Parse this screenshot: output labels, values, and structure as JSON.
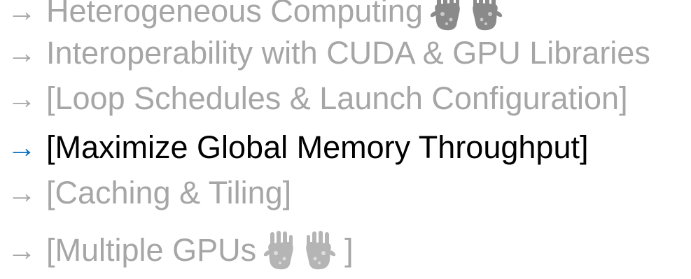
{
  "agenda": {
    "arrow": "→",
    "items": [
      {
        "text": "Heterogeneous Computing",
        "state": "inactive",
        "icon": "handprints-icon"
      },
      {
        "text": "Interoperability with CUDA & GPU Libraries",
        "state": "inactive"
      },
      {
        "text": "[Loop Schedules & Launch Configuration]",
        "state": "inactive"
      },
      {
        "text": "[Maximize Global Memory Throughput]",
        "state": "active"
      },
      {
        "text": "[Caching & Tiling]",
        "state": "inactive"
      },
      {
        "text": "[Multiple GPUs",
        "closing": "]",
        "state": "inactive",
        "icon": "handprints-icon"
      }
    ]
  },
  "colors": {
    "inactive_text": "#a6a6a6",
    "active_text": "#000000",
    "active_arrow": "#0b6fc0"
  }
}
